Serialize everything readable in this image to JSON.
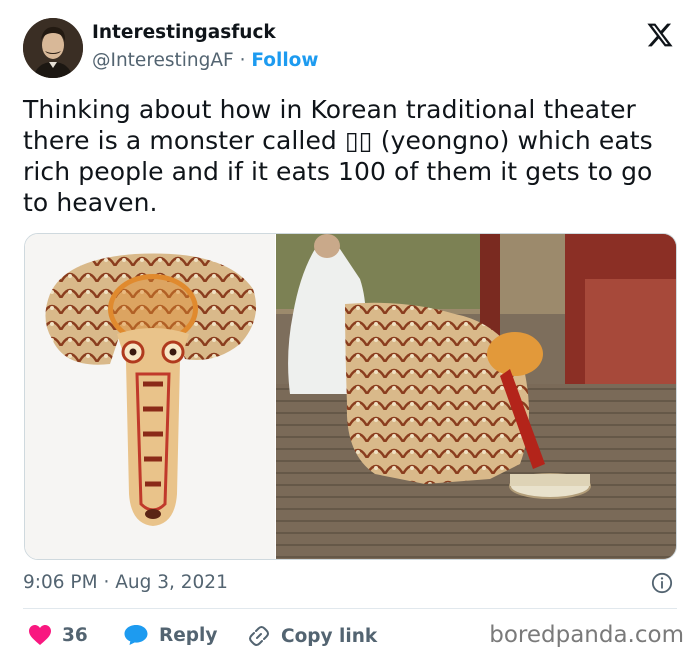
{
  "author": {
    "name": "Interestingasfuck",
    "handle": "@InterestingAF",
    "separator": "·",
    "follow_label": "Follow",
    "avatar_icon": "portrait-avatar"
  },
  "platform_icon": "x-logo-icon",
  "tweet": {
    "text": "Thinking about how in Korean traditional theater there is a monster called ▯▯ (yeongno) which eats rich people and if it eats 100 of them it gets to go to heaven."
  },
  "media": {
    "left_image": "yeongno-mask-photo",
    "right_image": "yeongno-performance-photo"
  },
  "meta": {
    "time": "9:06 PM",
    "separator": "·",
    "date": "Aug 3, 2021",
    "info_icon": "info-icon"
  },
  "actions": {
    "likes_count": "36",
    "reply_label": "Reply",
    "copy_label": "Copy link"
  },
  "watermark": "boredpanda.com",
  "colors": {
    "accent": "#1d9bf0",
    "like": "#f91880",
    "secondary_text": "#536471"
  }
}
